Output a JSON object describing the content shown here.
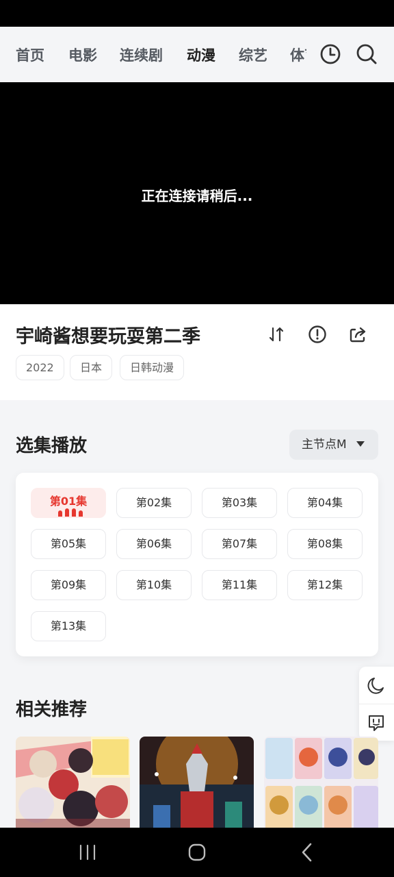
{
  "nav": {
    "tabs": [
      "首页",
      "电影",
      "连续剧",
      "动漫",
      "综艺",
      "体育"
    ],
    "active_tab": "动漫",
    "history_icon": "clock-icon",
    "search_icon": "search-icon"
  },
  "player": {
    "message": "正在连接请稍后..."
  },
  "info": {
    "title": "宇崎酱想要玩耍第二季",
    "tags": [
      "2022",
      "日本",
      "日韩动漫"
    ],
    "action_icons": [
      "sort-icon",
      "report-icon",
      "share-icon"
    ]
  },
  "episodes": {
    "section_title": "选集播放",
    "source_label": "主节点M",
    "items": [
      "第01集",
      "第02集",
      "第03集",
      "第04集",
      "第05集",
      "第06集",
      "第07集",
      "第08集",
      "第09集",
      "第10集",
      "第11集",
      "第12集",
      "第13集"
    ],
    "active": "第01集"
  },
  "recommend": {
    "section_title": "相关推荐"
  },
  "float_tools": [
    "moon-icon",
    "feedback-icon"
  ],
  "colors": {
    "accent_red": "#e6372f",
    "active_tab_highlight": "#f7cc5e",
    "page_background": "#f4f5f7"
  }
}
